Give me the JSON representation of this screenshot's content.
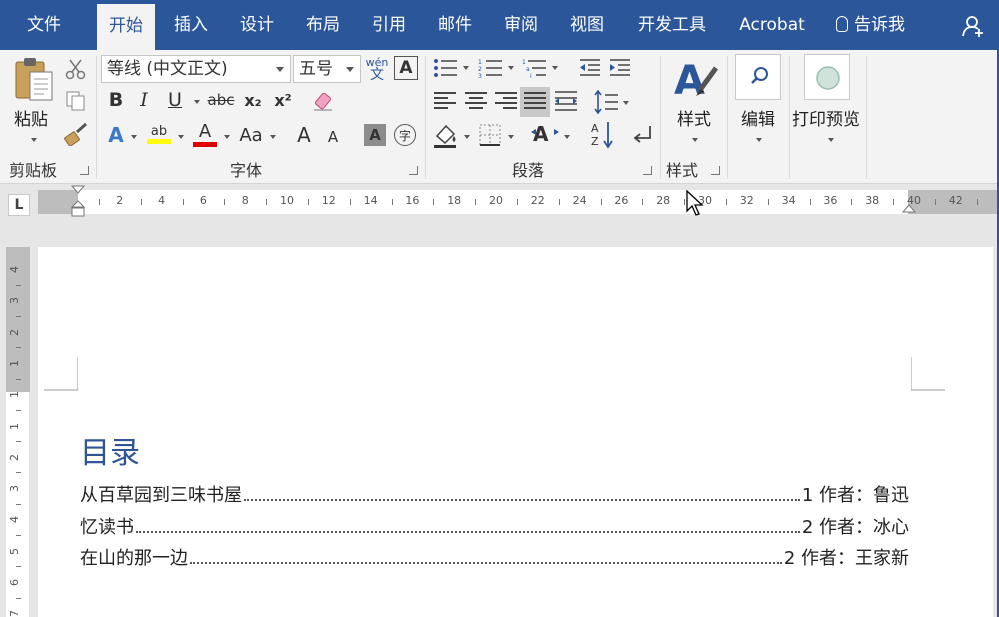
{
  "tabs": [
    {
      "label": "文件",
      "active": false
    },
    {
      "label": "开始",
      "active": true
    },
    {
      "label": "插入",
      "active": false
    },
    {
      "label": "设计",
      "active": false
    },
    {
      "label": "布局",
      "active": false
    },
    {
      "label": "引用",
      "active": false
    },
    {
      "label": "邮件",
      "active": false
    },
    {
      "label": "审阅",
      "active": false
    },
    {
      "label": "视图",
      "active": false
    },
    {
      "label": "开发工具",
      "active": false
    },
    {
      "label": "Acrobat",
      "active": false
    }
  ],
  "tell_me": "告诉我",
  "ribbon": {
    "clipboard": {
      "group_label": "剪贴板",
      "paste_label": "粘贴"
    },
    "font": {
      "group_label": "字体",
      "font_name": "等线 (中文正文)",
      "font_size": "五号",
      "phonetic_top": "wén",
      "phonetic_bottom": "文",
      "bold": "B",
      "italic": "I",
      "underline": "U",
      "strike": "abc",
      "sub": "x₂",
      "sup": "x²",
      "change_case": "Aa",
      "grow": "A",
      "shrink": "A",
      "enclose": "字",
      "shade": "A",
      "highlight": "ab",
      "color": "A",
      "effect": "A"
    },
    "paragraph": {
      "group_label": "段落"
    },
    "styles": {
      "group_label": "样式",
      "button_label": "样式"
    },
    "editing": {
      "button_label": "编辑"
    },
    "print_preview": {
      "button_label": "打印预览"
    }
  },
  "ruler": {
    "corner": "L",
    "labels": [
      "2",
      "4",
      "6",
      "8",
      "10",
      "12",
      "14",
      "16",
      "18",
      "20",
      "22",
      "24",
      "26",
      "28",
      "30",
      "32",
      "34",
      "36",
      "38",
      "40",
      "42"
    ]
  },
  "vruler": {
    "labels": [
      "4",
      "3",
      "2",
      "1",
      "1",
      "1",
      "2",
      "3",
      "4",
      "5",
      "6",
      "7"
    ]
  },
  "document": {
    "toc_title": "目录",
    "entries": [
      {
        "title": "从百草园到三味书屋",
        "suffix": "1 作者：鲁迅"
      },
      {
        "title": "忆读书",
        "suffix": "2 作者：冰心"
      },
      {
        "title": "在山的那一边",
        "suffix": "2 作者：王家新"
      }
    ]
  },
  "colors": {
    "accent": "#2b579a",
    "heading": "#2f5597",
    "highlight": "#ffff00",
    "font_color": "#e00000"
  }
}
